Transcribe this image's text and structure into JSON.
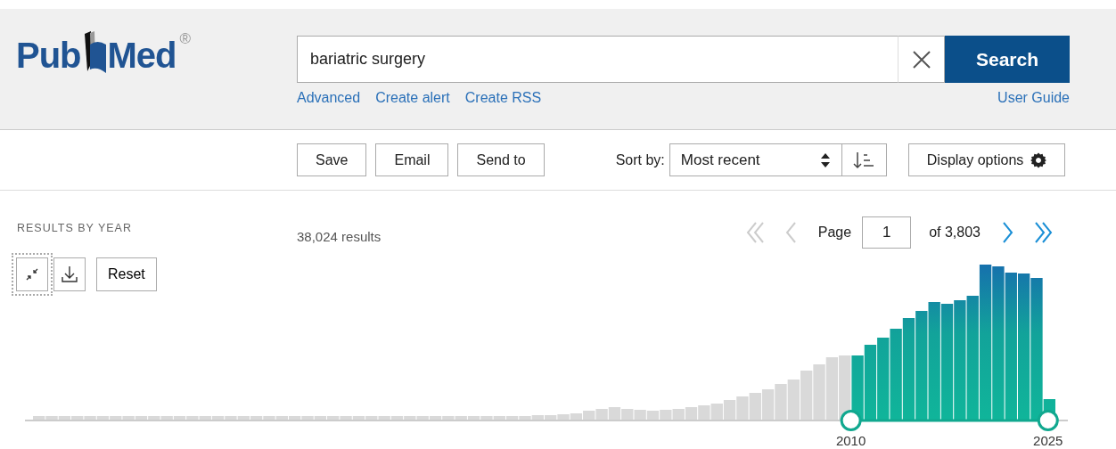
{
  "logo": {
    "parts": [
      "Pub",
      "Med"
    ],
    "mark": "®"
  },
  "search": {
    "value": "bariatric surgery",
    "button": "Search",
    "links": [
      "Advanced",
      "Create alert",
      "Create RSS"
    ],
    "help_link": "User Guide"
  },
  "actions": [
    "Save",
    "Email",
    "Send to"
  ],
  "sort": {
    "label": "Sort by:",
    "value": "Most recent"
  },
  "display_options": "Display options",
  "timeline": {
    "title": "RESULTS BY YEAR",
    "reset": "Reset",
    "range_handles": [
      {
        "label": "2010",
        "level": 0.792
      },
      {
        "label": "2025",
        "level": 0.981
      }
    ]
  },
  "results": {
    "count": "38,024 results"
  },
  "pager": {
    "label": "Page",
    "page": "1",
    "total": "of 3,803",
    "buttons": [
      {
        "kind": "first",
        "disabled": true
      },
      {
        "kind": "prev",
        "disabled": true
      },
      {
        "kind": "next",
        "disabled": false
      },
      {
        "kind": "last",
        "disabled": false
      }
    ]
  }
}
